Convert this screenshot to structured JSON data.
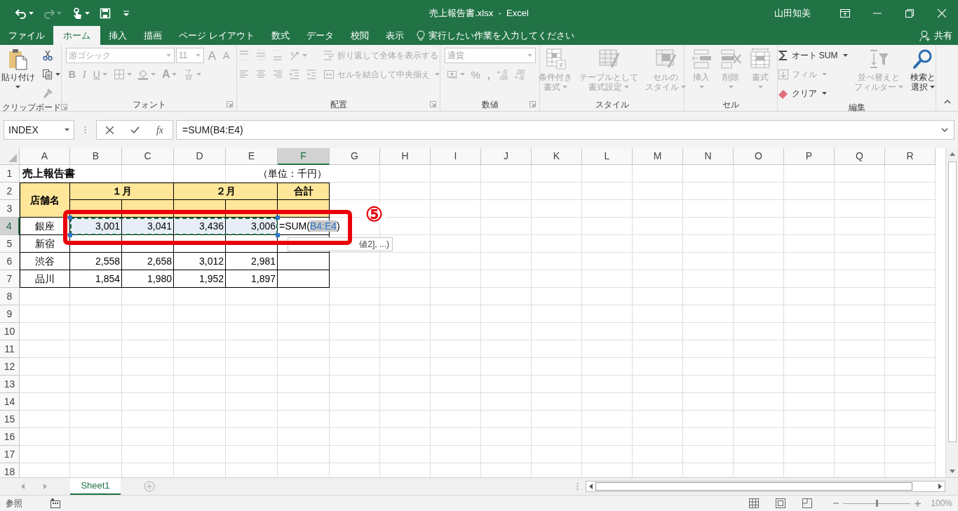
{
  "title_bar": {
    "quick_access": [
      {
        "disabled": false
      },
      {
        "disabled": true
      },
      {
        "disabled": false
      },
      {
        "disabled": false
      }
    ],
    "title": "売上報告書.xlsx  -  Excel",
    "user": "山田知美"
  },
  "tabs": [
    {
      "label": "ファイル",
      "selected": false
    },
    {
      "label": "ホーム",
      "selected": true
    },
    {
      "label": "挿入",
      "selected": false
    },
    {
      "label": "描画",
      "selected": false
    },
    {
      "label": "ページ レイアウト",
      "selected": false
    },
    {
      "label": "数式",
      "selected": false
    },
    {
      "label": "データ",
      "selected": false
    },
    {
      "label": "校閲",
      "selected": false
    },
    {
      "label": "表示",
      "selected": false
    }
  ],
  "tell_me": {
    "placeholder": "実行したい作業を入力してください"
  },
  "share": "共有",
  "ribbon": {
    "groups": [
      {
        "label": "クリップボード",
        "launcher": true,
        "columns": [
          [
            {
              "kind": "large",
              "label": [
                "貼り付け"
              ],
              "dropdown": true,
              "disabled": false
            }
          ],
          [
            {
              "kind": "icon",
              "dropdown": false,
              "disabled": false
            },
            {
              "kind": "icon",
              "dropdown": true,
              "disabled": false
            },
            {
              "kind": "icon",
              "dropdown": false,
              "disabled": true
            }
          ]
        ]
      },
      {
        "label": "フォント",
        "launcher": true,
        "columns": [
          [
            {
              "kind": "strip",
              "items": [
                {
                  "kind": "combo",
                  "value": "游ゴシック",
                  "disabled": true
                },
                {
                  "kind": "combo",
                  "value": "11",
                  "disabled": true
                },
                {
                  "kind": "glyph",
                  "text": "A",
                  "dropdown": false,
                  "disabled": true
                },
                {
                  "kind": "glyph",
                  "text": "A",
                  "dropdown": false,
                  "disabled": true
                }
              ]
            },
            {
              "kind": "strip",
              "items": [
                {
                  "kind": "glyph",
                  "text": "B",
                  "dropdown": false,
                  "disabled": true
                },
                {
                  "kind": "glyph",
                  "text": "I",
                  "dropdown": false,
                  "disabled": true
                },
                {
                  "kind": "glyph",
                  "text": "U",
                  "dropdown": true,
                  "disabled": true
                },
                {
                  "kind": "icon",
                  "dropdown": true,
                  "disabled": true
                },
                {
                  "kind": "icon",
                  "dropdown": true,
                  "disabled": true
                },
                {
                  "kind": "glyph",
                  "text": "A",
                  "dropdown": true,
                  "disabled": true
                },
                {
                  "kind": "icon",
                  "dropdown": true,
                  "disabled": true
                }
              ]
            }
          ]
        ]
      },
      {
        "label": "配置",
        "launcher": true,
        "columns": [
          [
            {
              "kind": "strip",
              "items": [
                {
                  "kind": "icon",
                  "dropdown": false,
                  "disabled": true
                },
                {
                  "kind": "icon",
                  "dropdown": false,
                  "disabled": true
                },
                {
                  "kind": "icon",
                  "dropdown": false,
                  "disabled": true
                },
                {
                  "kind": "icon",
                  "dropdown": true,
                  "disabled": true
                }
              ]
            },
            {
              "kind": "strip",
              "items": [
                {
                  "kind": "icon",
                  "dropdown": false,
                  "disabled": true
                },
                {
                  "kind": "icon",
                  "dropdown": false,
                  "disabled": true
                },
                {
                  "kind": "icon",
                  "dropdown": false,
                  "disabled": true
                },
                {
                  "kind": "icon",
                  "dropdown": false,
                  "disabled": true
                },
                {
                  "kind": "icon",
                  "dropdown": false,
                  "disabled": true
                }
              ]
            }
          ],
          [
            {
              "kind": "small",
              "label": "折り返して全体を表示する",
              "dropdown": false,
              "disabled": true
            },
            {
              "kind": "small",
              "label": "セルを結合して中央揃え",
              "dropdown": true,
              "disabled": true
            }
          ]
        ]
      },
      {
        "label": "数値",
        "launcher": true,
        "columns": [
          [
            {
              "kind": "combo",
              "value": "通貨",
              "disabled": true
            },
            {
              "kind": "strip",
              "items": [
                {
                  "kind": "icon",
                  "dropdown": true,
                  "disabled": true
                },
                {
                  "kind": "glyph",
                  "text": "%",
                  "dropdown": false,
                  "disabled": true
                },
                {
                  "kind": "glyph",
                  "text": ",",
                  "dropdown": false,
                  "disabled": true
                },
                {
                  "kind": "icon",
                  "dropdown": false,
                  "disabled": true
                },
                {
                  "kind": "icon",
                  "dropdown": false,
                  "disabled": true
                }
              ]
            }
          ]
        ]
      },
      {
        "label": "スタイル",
        "launcher": false,
        "columns": [
          [
            {
              "kind": "large",
              "label": [
                "条件付き",
                "書式"
              ],
              "dropdown": true,
              "disabled": true
            }
          ],
          [
            {
              "kind": "large",
              "label": [
                "テーブルとして",
                "書式設定"
              ],
              "dropdown": true,
              "disabled": true
            }
          ],
          [
            {
              "kind": "large",
              "label": [
                "セルの",
                "スタイル"
              ],
              "dropdown": true,
              "disabled": true
            }
          ]
        ]
      },
      {
        "label": "セル",
        "launcher": false,
        "columns": [
          [
            {
              "kind": "large",
              "label": [
                "挿入"
              ],
              "dropdown": true,
              "disabled": true
            }
          ],
          [
            {
              "kind": "large",
              "label": [
                "削除"
              ],
              "dropdown": true,
              "disabled": true
            }
          ],
          [
            {
              "kind": "large",
              "label": [
                "書式"
              ],
              "dropdown": true,
              "disabled": true
            }
          ]
        ]
      },
      {
        "label": "編集",
        "launcher": false,
        "columns": [
          [
            {
              "kind": "small",
              "label": "オート SUM",
              "dropdown": true,
              "disabled": false
            },
            {
              "kind": "small",
              "label": "フィル",
              "dropdown": true,
              "disabled": true
            },
            {
              "kind": "small",
              "label": "クリア",
              "dropdown": true,
              "disabled": false
            }
          ],
          [
            {
              "kind": "large",
              "label": [
                "並べ替えと",
                "フィルター"
              ],
              "dropdown": true,
              "disabled": true
            }
          ],
          [
            {
              "kind": "large",
              "label": [
                "検索と",
                "選択"
              ],
              "dropdown": true,
              "disabled": false
            }
          ]
        ]
      }
    ]
  },
  "formula_bar": {
    "name_box": "INDEX",
    "function_button": "fx",
    "formula": "=SUM(B4:E4)"
  },
  "sheet": {
    "columns": [
      {
        "label": "A",
        "selected": false
      },
      {
        "label": "B",
        "selected": false
      },
      {
        "label": "C",
        "selected": false
      },
      {
        "label": "D",
        "selected": false
      },
      {
        "label": "E",
        "selected": false
      },
      {
        "label": "F",
        "selected": true
      },
      {
        "label": "G",
        "selected": false
      },
      {
        "label": "H",
        "selected": false
      },
      {
        "label": "I",
        "selected": false
      },
      {
        "label": "J",
        "selected": false
      },
      {
        "label": "K",
        "selected": false
      },
      {
        "label": "L",
        "selected": false
      },
      {
        "label": "M",
        "selected": false
      },
      {
        "label": "N",
        "selected": false
      },
      {
        "label": "O",
        "selected": false
      },
      {
        "label": "P",
        "selected": false
      },
      {
        "label": "Q",
        "selected": false
      },
      {
        "label": "R",
        "selected": false
      }
    ],
    "rows": [
      {
        "label": "1",
        "selected": false
      },
      {
        "label": "2",
        "selected": false
      },
      {
        "label": "3",
        "selected": false
      },
      {
        "label": "4",
        "selected": true
      },
      {
        "label": "5",
        "selected": false
      },
      {
        "label": "6",
        "selected": false
      },
      {
        "label": "7",
        "selected": false
      },
      {
        "label": "8",
        "selected": false
      },
      {
        "label": "9",
        "selected": false
      },
      {
        "label": "10",
        "selected": false
      },
      {
        "label": "11",
        "selected": false
      },
      {
        "label": "12",
        "selected": false
      },
      {
        "label": "13",
        "selected": false
      },
      {
        "label": "14",
        "selected": false
      },
      {
        "label": "15",
        "selected": false
      },
      {
        "label": "16",
        "selected": false
      },
      {
        "label": "17",
        "selected": false
      },
      {
        "label": "18",
        "selected": false
      }
    ],
    "title_cell": "売上報告書",
    "unit_note": "（単位：千円）",
    "table": [
      [
        {
          "kind": "header",
          "text": "店舗名",
          "spans_two_columns": false,
          "spans_two_rows": true,
          "highlighted": false
        },
        {
          "kind": "header",
          "text": "１月",
          "spans_two_columns": true,
          "spans_two_rows": false,
          "highlighted": false
        },
        {
          "kind": "header",
          "text": "２月",
          "spans_two_columns": true,
          "spans_two_rows": false,
          "highlighted": false
        },
        {
          "kind": "header",
          "text": "合計",
          "spans_two_columns": false,
          "spans_two_rows": false,
          "highlighted": false
        }
      ],
      [
        {
          "kind": "header",
          "spans_two_columns": false,
          "spans_two_rows": false,
          "highlighted": false
        },
        {
          "kind": "header",
          "spans_two_columns": false,
          "spans_two_rows": false,
          "highlighted": false
        },
        {
          "kind": "header",
          "spans_two_columns": false,
          "spans_two_rows": false,
          "highlighted": false
        },
        {
          "kind": "header",
          "spans_two_columns": false,
          "spans_two_rows": false,
          "highlighted": false
        },
        {
          "kind": "header",
          "spans_two_columns": false,
          "spans_two_rows": false,
          "highlighted": false
        }
      ],
      [
        {
          "kind": "label",
          "text": "銀座",
          "spans_two_columns": false,
          "spans_two_rows": false,
          "highlighted": false
        },
        {
          "kind": "number",
          "text": "3,001",
          "spans_two_columns": false,
          "spans_two_rows": false,
          "highlighted": true
        },
        {
          "kind": "number",
          "text": "3,041",
          "spans_two_columns": false,
          "spans_two_rows": false,
          "highlighted": true
        },
        {
          "kind": "number",
          "text": "3,436",
          "spans_two_columns": false,
          "spans_two_rows": false,
          "highlighted": true
        },
        {
          "kind": "number",
          "text": "3,006",
          "spans_two_columns": false,
          "spans_two_rows": false,
          "highlighted": true
        },
        {
          "kind": "formula",
          "prefix": "=SUM(",
          "reference": "B4:E4",
          "suffix": ")",
          "spans_two_columns": false,
          "spans_two_rows": false,
          "highlighted": false
        }
      ],
      [
        {
          "kind": "label",
          "text": "新宿",
          "spans_two_columns": false,
          "spans_two_rows": false,
          "highlighted": false
        },
        {
          "kind": "number",
          "spans_two_columns": false,
          "spans_two_rows": false,
          "highlighted": false
        },
        {
          "kind": "number",
          "spans_two_columns": false,
          "spans_two_rows": false,
          "highlighted": false
        },
        {
          "kind": "number",
          "spans_two_columns": false,
          "spans_two_rows": false,
          "highlighted": false
        },
        {
          "kind": "number",
          "spans_two_columns": false,
          "spans_two_rows": false,
          "highlighted": false
        },
        {
          "kind": "blank",
          "spans_two_columns": false,
          "spans_two_rows": false,
          "highlighted": false
        }
      ],
      [
        {
          "kind": "label",
          "text": "渋谷",
          "spans_two_columns": false,
          "spans_two_rows": false,
          "highlighted": false
        },
        {
          "kind": "number",
          "text": "2,558",
          "spans_two_columns": false,
          "spans_two_rows": false,
          "highlighted": false
        },
        {
          "kind": "number",
          "text": "2,658",
          "spans_two_columns": false,
          "spans_two_rows": false,
          "highlighted": false
        },
        {
          "kind": "number",
          "text": "3,012",
          "spans_two_columns": false,
          "spans_two_rows": false,
          "highlighted": false
        },
        {
          "kind": "number",
          "text": "2,981",
          "spans_two_columns": false,
          "spans_two_rows": false,
          "highlighted": false
        },
        {
          "kind": "blank",
          "spans_two_columns": false,
          "spans_two_rows": false,
          "highlighted": false
        }
      ],
      [
        {
          "kind": "label",
          "text": "品川",
          "spans_two_columns": false,
          "spans_two_rows": false,
          "highlighted": false
        },
        {
          "kind": "number",
          "text": "1,854",
          "spans_two_columns": false,
          "spans_two_rows": false,
          "highlighted": false
        },
        {
          "kind": "number",
          "text": "1,980",
          "spans_two_columns": false,
          "spans_two_rows": false,
          "highlighted": false
        },
        {
          "kind": "number",
          "text": "1,952",
          "spans_two_columns": false,
          "spans_two_rows": false,
          "highlighted": false
        },
        {
          "kind": "number",
          "text": "1,897",
          "spans_two_columns": false,
          "spans_two_rows": false,
          "highlighted": false
        },
        {
          "kind": "blank",
          "spans_two_columns": false,
          "spans_two_rows": false,
          "highlighted": false
        }
      ]
    ],
    "tooltip": "値2], ...)",
    "annotation": {
      "marker": "⑤"
    }
  },
  "sheet_tabs": [
    {
      "label": "Sheet1",
      "selected": true
    }
  ],
  "status_bar": {
    "mode": "参照",
    "zoom": {
      "reading": "100%",
      "level": 0.5
    }
  }
}
